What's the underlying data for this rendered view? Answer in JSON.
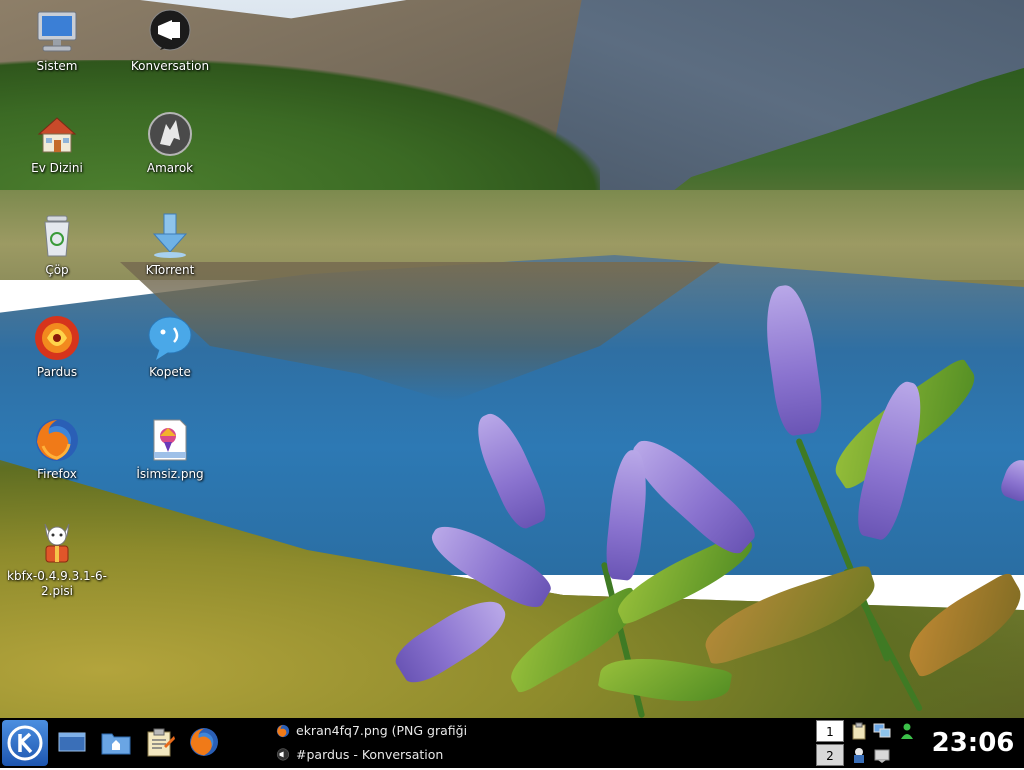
{
  "desktop": {
    "icons": [
      {
        "label": "Sistem",
        "icon": "computer-monitor-icon"
      },
      {
        "label": "Konversation",
        "icon": "megaphone-icon"
      },
      {
        "label": "Ev Dizini",
        "icon": "home-folder-icon"
      },
      {
        "label": "Amarok",
        "icon": "wolf-icon"
      },
      {
        "label": "Çöp",
        "icon": "trash-bin-icon"
      },
      {
        "label": "KTorrent",
        "icon": "download-arrow-icon"
      },
      {
        "label": "Pardus",
        "icon": "pardus-logo-icon"
      },
      {
        "label": "Kopete",
        "icon": "chat-bubble-icon"
      },
      {
        "label": "Firefox",
        "icon": "firefox-icon"
      },
      {
        "label": "İsimsiz.png",
        "icon": "image-file-icon"
      },
      {
        "label": "kbfx-0.4.9.3.1-6-2.pisi",
        "icon": "package-cat-icon"
      }
    ]
  },
  "taskbar": {
    "launchers": [
      "kde-menu-icon",
      "show-desktop-icon",
      "file-manager-icon",
      "office-clipboard-icon",
      "firefox-icon"
    ],
    "tasks": [
      {
        "title": "ekran4fq7.png (PNG grafiği",
        "icon": "firefox-icon"
      },
      {
        "title": "#pardus - Konversation",
        "icon": "megaphone-icon"
      }
    ],
    "pager": [
      "1",
      "2"
    ],
    "tray_icons": [
      "clipboard-icon",
      "network-icon",
      "user-status-icon",
      "package-manager-icon",
      "volume-icon"
    ],
    "clock": "23:06"
  },
  "colors": {
    "taskbar_bg": "#000000",
    "active_desktop_bg": "#ffffff",
    "inactive_desktop_bg": "#d8d8d8"
  }
}
